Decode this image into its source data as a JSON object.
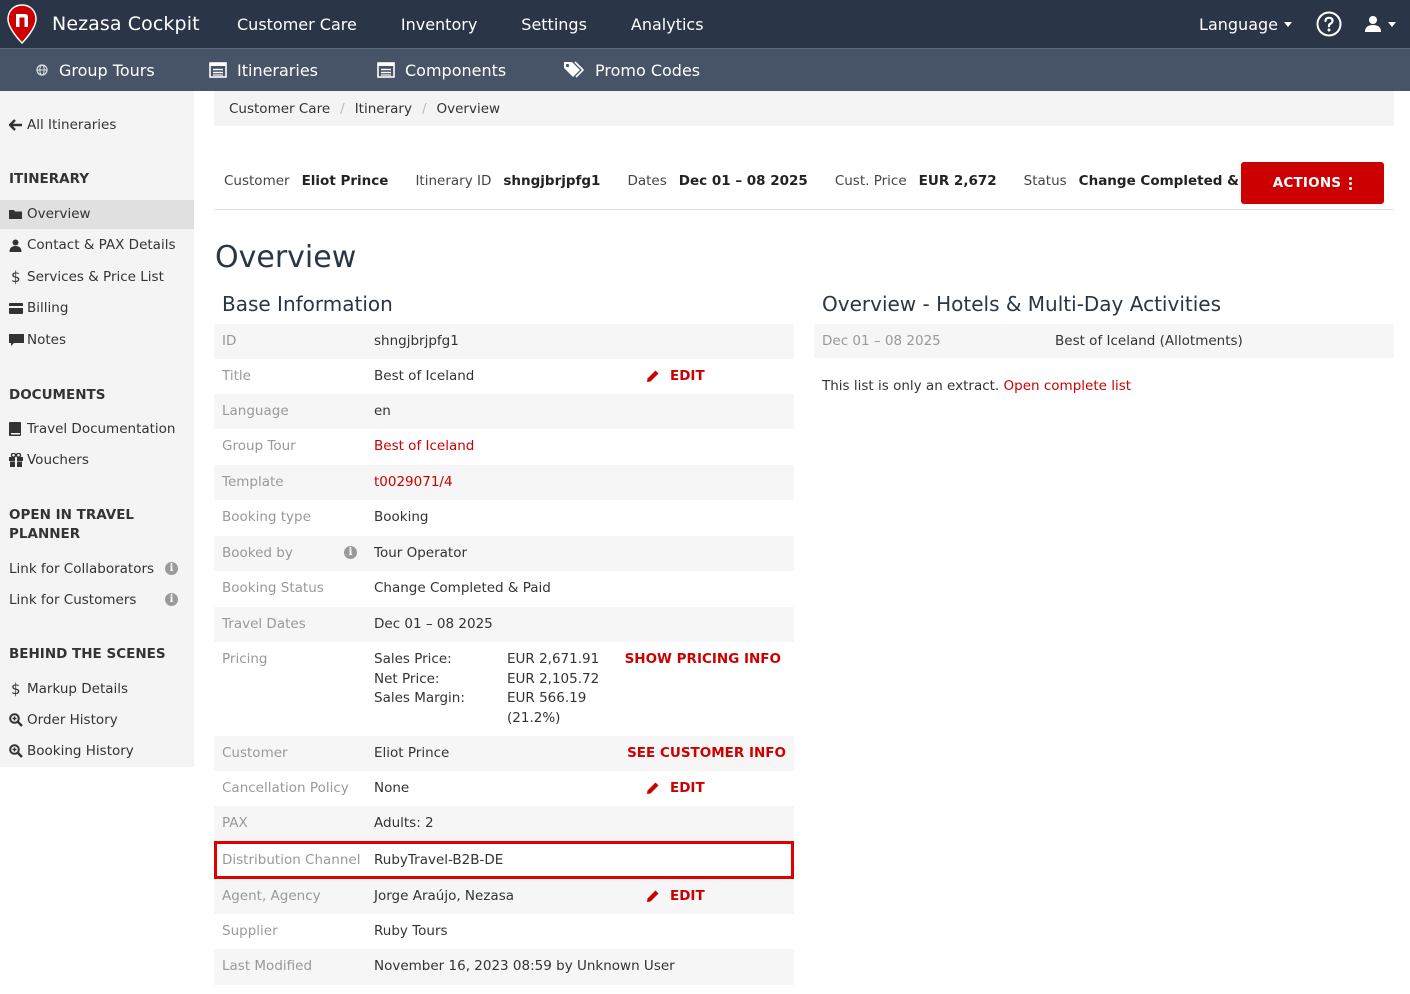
{
  "app": {
    "brand": "Nezasa Cockpit",
    "accent": "#cc0000",
    "navbar_bg": "#2a3547",
    "subbar_bg": "#475467"
  },
  "topnav": {
    "items": [
      "Customer Care",
      "Inventory",
      "Settings",
      "Analytics"
    ],
    "language": "Language"
  },
  "subnav": {
    "items": [
      {
        "label": "Group Tours",
        "icon": "group-tours-icon"
      },
      {
        "label": "Itineraries",
        "icon": "list-icon"
      },
      {
        "label": "Components",
        "icon": "list-icon"
      },
      {
        "label": "Promo Codes",
        "icon": "tags-icon"
      }
    ]
  },
  "sidebar": {
    "back": "All Itineraries",
    "sections": [
      {
        "title": "ITINERARY",
        "items": [
          "Overview",
          "Contact & PAX Details",
          "Services & Price List",
          "Billing",
          "Notes"
        ]
      },
      {
        "title": "DOCUMENTS",
        "items": [
          "Travel Documentation",
          "Vouchers"
        ]
      },
      {
        "title": "OPEN IN TRAVEL PLANNER",
        "items": [
          "Link for Collaborators",
          "Link for Customers"
        ]
      },
      {
        "title": "BEHIND THE SCENES",
        "items": [
          "Markup Details",
          "Order History",
          "Booking History"
        ]
      }
    ]
  },
  "breadcrumb": [
    "Customer Care",
    "Itinerary",
    "Overview"
  ],
  "header": {
    "customer_label": "Customer",
    "customer": "Eliot Prince",
    "id_label": "Itinerary ID",
    "id": "shngjbrjpfg1",
    "dates_label": "Dates",
    "dates": "Dec 01 – 08 2025",
    "price_label": "Cust. Price",
    "price": "EUR 2,672",
    "status_label": "Status",
    "status": "Change Completed & Paid",
    "actions": "ACTIONS"
  },
  "page_title": "Overview",
  "base_info": {
    "title": "Base Information",
    "edit": "EDIT",
    "rows": {
      "id": {
        "k": "ID",
        "v": "shngjbrjpfg1"
      },
      "title": {
        "k": "Title",
        "v": "Best of Iceland"
      },
      "language": {
        "k": "Language",
        "v": "en"
      },
      "group_tour": {
        "k": "Group Tour",
        "v": "Best of Iceland"
      },
      "template": {
        "k": "Template",
        "v": "t0029071/4"
      },
      "booking_type": {
        "k": "Booking type",
        "v": "Booking"
      },
      "booked_by": {
        "k": "Booked by",
        "v": "Tour Operator"
      },
      "booking_status": {
        "k": "Booking Status",
        "v": "Change Completed & Paid"
      },
      "travel_dates": {
        "k": "Travel Dates",
        "v": "Dec 01 – 08 2025"
      },
      "pricing": {
        "k": "Pricing",
        "sales_label": "Sales Price:",
        "sales": "EUR 2,671.91",
        "net_label": "Net Price:",
        "net": "EUR 2,105.72",
        "margin_label": "Sales Margin:",
        "margin": "EUR 566.19",
        "margin_pct": "(21.2%)",
        "action": "SHOW PRICING INFO"
      },
      "customer": {
        "k": "Customer",
        "v": "Eliot Prince",
        "action": "SEE CUSTOMER INFO"
      },
      "cancellation": {
        "k": "Cancellation Policy",
        "v": "None"
      },
      "pax": {
        "k": "PAX",
        "v": "Adults: 2"
      },
      "distribution": {
        "k": "Distribution Channel",
        "v": "RubyTravel-B2B-DE"
      },
      "agent": {
        "k": "Agent, Agency",
        "v": "Jorge Araújo, Nezasa"
      },
      "supplier": {
        "k": "Supplier",
        "v": "Ruby Tours"
      },
      "modified": {
        "k": "Last Modified",
        "v": "November 16, 2023 08:59 by Unknown User"
      }
    }
  },
  "hotels": {
    "title": "Overview - Hotels & Multi-Day Activities",
    "dates": "Dec 01 – 08 2025",
    "name": "Best of Iceland (Allotments)",
    "extract_text": "This list is only an extract.",
    "extract_link": "Open complete list"
  }
}
